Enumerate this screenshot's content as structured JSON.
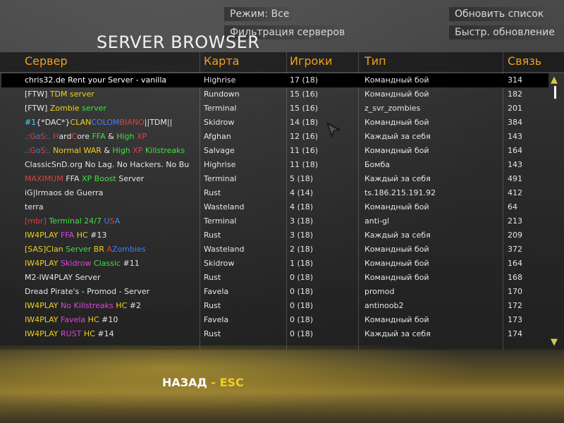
{
  "menu": {
    "mode_label": "Режим:  Все",
    "filter_label": "Фильтрация серверов",
    "refresh_label": "Обновить список",
    "quick_refresh_label": "Быстр. обновление"
  },
  "title": "SERVER BROWSER",
  "columns": {
    "server": "Сервер",
    "map": "Карта",
    "players": "Игроки",
    "type": "Тип",
    "ping": "Связь"
  },
  "colors": {
    "header": "#f0a020",
    "accent_yellow": "#f0d020",
    "background": "#3b3b3b"
  },
  "rows": [
    {
      "server": [
        {
          "t": "chris32.de Rent your Server - vanilla",
          "c": "#ffffff"
        }
      ],
      "map": "Highrise",
      "players": "17 (18)",
      "type": "Командный бой",
      "ping": "314",
      "selected": true
    },
    {
      "server": [
        {
          "t": "[FTW] ",
          "c": "#e6e6e6"
        },
        {
          "t": "TDM server",
          "c": "#f0d020"
        }
      ],
      "map": "Rundown",
      "players": "15 (16)",
      "type": "Командный бой",
      "ping": "182"
    },
    {
      "server": [
        {
          "t": "[FTW] ",
          "c": "#e6e6e6"
        },
        {
          "t": "Zombie",
          "c": "#f0d020"
        },
        {
          "t": " server",
          "c": "#40e040"
        }
      ],
      "map": "Terminal",
      "players": "15 (16)",
      "type": "z_svr_zombies",
      "ping": "201"
    },
    {
      "server": [
        {
          "t": "#1",
          "c": "#40e0ff"
        },
        {
          "t": "{*DAC*}",
          "c": "#e6e6e6"
        },
        {
          "t": "CLAN",
          "c": "#f0d020"
        },
        {
          "t": "COLOM",
          "c": "#4080ff"
        },
        {
          "t": "BIANO",
          "c": "#e04040"
        },
        {
          "t": "||TDM||",
          "c": "#e6e6e6"
        }
      ],
      "map": "Skidrow",
      "players": "14 (18)",
      "type": "Командный бой",
      "ping": "384"
    },
    {
      "server": [
        {
          "t": ".:",
          "c": "#4080ff"
        },
        {
          "t": "G",
          "c": "#e04040"
        },
        {
          "t": "o",
          "c": "#4080ff"
        },
        {
          "t": "S",
          "c": "#e04040"
        },
        {
          "t": ":. ",
          "c": "#4080ff"
        },
        {
          "t": "H",
          "c": "#e04040"
        },
        {
          "t": "ard",
          "c": "#e6e6e6"
        },
        {
          "t": "C",
          "c": "#e04040"
        },
        {
          "t": "ore ",
          "c": "#e6e6e6"
        },
        {
          "t": "FFA",
          "c": "#40e040"
        },
        {
          "t": " & ",
          "c": "#e6e6e6"
        },
        {
          "t": "High",
          "c": "#40e040"
        },
        {
          "t": " XP",
          "c": "#e04040"
        }
      ],
      "map": "Afghan",
      "players": "12 (16)",
      "type": "Каждый за себя",
      "ping": "143"
    },
    {
      "server": [
        {
          "t": ".:",
          "c": "#4080ff"
        },
        {
          "t": "G",
          "c": "#e04040"
        },
        {
          "t": "o",
          "c": "#4080ff"
        },
        {
          "t": "S",
          "c": "#e04040"
        },
        {
          "t": ":. ",
          "c": "#4080ff"
        },
        {
          "t": "Normal",
          "c": "#f0d020"
        },
        {
          "t": " WAR",
          "c": "#f0d020"
        },
        {
          "t": " & ",
          "c": "#e6e6e6"
        },
        {
          "t": "High",
          "c": "#40e040"
        },
        {
          "t": " XP",
          "c": "#e04040"
        },
        {
          "t": " Killstreaks",
          "c": "#40e040"
        }
      ],
      "map": "Salvage",
      "players": "11 (16)",
      "type": "Командный бой",
      "ping": "164"
    },
    {
      "server": [
        {
          "t": "ClassicSnD.org No Lag. No Hackers. No Bu",
          "c": "#e6e6e6"
        }
      ],
      "map": "Highrise",
      "players": "11 (18)",
      "type": "Бомба",
      "ping": "143"
    },
    {
      "server": [
        {
          "t": "MAXIMUM",
          "c": "#e04040"
        },
        {
          "t": " FFA ",
          "c": "#e6e6e6"
        },
        {
          "t": "XP Boost",
          "c": "#40e040"
        },
        {
          "t": " Server",
          "c": "#e6e6e6"
        }
      ],
      "map": "Terminal",
      "players": "5 (18)",
      "type": "Каждый за себя",
      "ping": "491"
    },
    {
      "server": [
        {
          "t": "iG|Irmaos de Guerra",
          "c": "#e6e6e6"
        }
      ],
      "map": "Rust",
      "players": "4 (14)",
      "type": "ts.186.215.191.92",
      "ping": "412"
    },
    {
      "server": [
        {
          "t": "terra",
          "c": "#e6e6e6"
        }
      ],
      "map": "Wasteland",
      "players": "4 (18)",
      "type": "Командный бой",
      "ping": "64"
    },
    {
      "server": [
        {
          "t": "[mbr] ",
          "c": "#e04040"
        },
        {
          "t": "Terminal 24/7 ",
          "c": "#40e040"
        },
        {
          "t": "U",
          "c": "#4080ff"
        },
        {
          "t": "S",
          "c": "#e04040"
        },
        {
          "t": "A",
          "c": "#4080ff"
        }
      ],
      "map": "Terminal",
      "players": "3 (18)",
      "type": "anti-gl",
      "ping": "213"
    },
    {
      "server": [
        {
          "t": "IW4PLAY ",
          "c": "#f0d020"
        },
        {
          "t": "FFA",
          "c": "#e040e0"
        },
        {
          "t": " HC ",
          "c": "#f0d020"
        },
        {
          "t": "#13",
          "c": "#e6e6e6"
        }
      ],
      "map": "Rust",
      "players": "3 (18)",
      "type": "Каждый за себя",
      "ping": "209"
    },
    {
      "server": [
        {
          "t": "[SAS]Clan ",
          "c": "#f0d020"
        },
        {
          "t": "Server",
          "c": "#40e040"
        },
        {
          "t": " BR ",
          "c": "#f0d020"
        },
        {
          "t": "A",
          "c": "#e04040"
        },
        {
          "t": "Zombies",
          "c": "#4080ff"
        }
      ],
      "map": "Wasteland",
      "players": "2 (18)",
      "type": "Командный бой",
      "ping": "372"
    },
    {
      "server": [
        {
          "t": "IW4PLAY ",
          "c": "#f0d020"
        },
        {
          "t": "Skidrow",
          "c": "#e040e0"
        },
        {
          "t": " Classic",
          "c": "#40e040"
        },
        {
          "t": " #11",
          "c": "#e6e6e6"
        }
      ],
      "map": "Skidrow",
      "players": "1 (18)",
      "type": "Командный бой",
      "ping": "164"
    },
    {
      "server": [
        {
          "t": "M2-IW4PLAY Server",
          "c": "#e6e6e6"
        }
      ],
      "map": "Rust",
      "players": "0 (18)",
      "type": "Командный бой",
      "ping": "168"
    },
    {
      "server": [
        {
          "t": "Dread Pirate's - Promod - Server",
          "c": "#e6e6e6"
        }
      ],
      "map": "Favela",
      "players": "0 (18)",
      "type": "promod",
      "ping": "170"
    },
    {
      "server": [
        {
          "t": "IW4PLAY ",
          "c": "#f0d020"
        },
        {
          "t": "No Killstreaks",
          "c": "#e040e0"
        },
        {
          "t": " HC ",
          "c": "#f0d020"
        },
        {
          "t": "#2",
          "c": "#e6e6e6"
        }
      ],
      "map": "Rust",
      "players": "0 (18)",
      "type": "antinoob2",
      "ping": "172"
    },
    {
      "server": [
        {
          "t": "IW4PLAY ",
          "c": "#f0d020"
        },
        {
          "t": "Favela",
          "c": "#e040e0"
        },
        {
          "t": " HC ",
          "c": "#f0d020"
        },
        {
          "t": "#10",
          "c": "#e6e6e6"
        }
      ],
      "map": "Favela",
      "players": "0 (18)",
      "type": "Командный бой",
      "ping": "173"
    },
    {
      "server": [
        {
          "t": "IW4PLAY ",
          "c": "#f0d020"
        },
        {
          "t": "RUST",
          "c": "#e040e0"
        },
        {
          "t": " HC ",
          "c": "#f0d020"
        },
        {
          "t": "#14",
          "c": "#e6e6e6"
        }
      ],
      "map": "Rust",
      "players": "0 (18)",
      "type": "Каждый за себя",
      "ping": "174"
    }
  ],
  "back": {
    "label": "НАЗАД",
    "separator": " - ",
    "key": "ESC"
  },
  "icons": {
    "scroll_up": "chevron-up-icon",
    "scroll_down": "chevron-down-icon",
    "cursor": "cursor-arrow-icon"
  }
}
